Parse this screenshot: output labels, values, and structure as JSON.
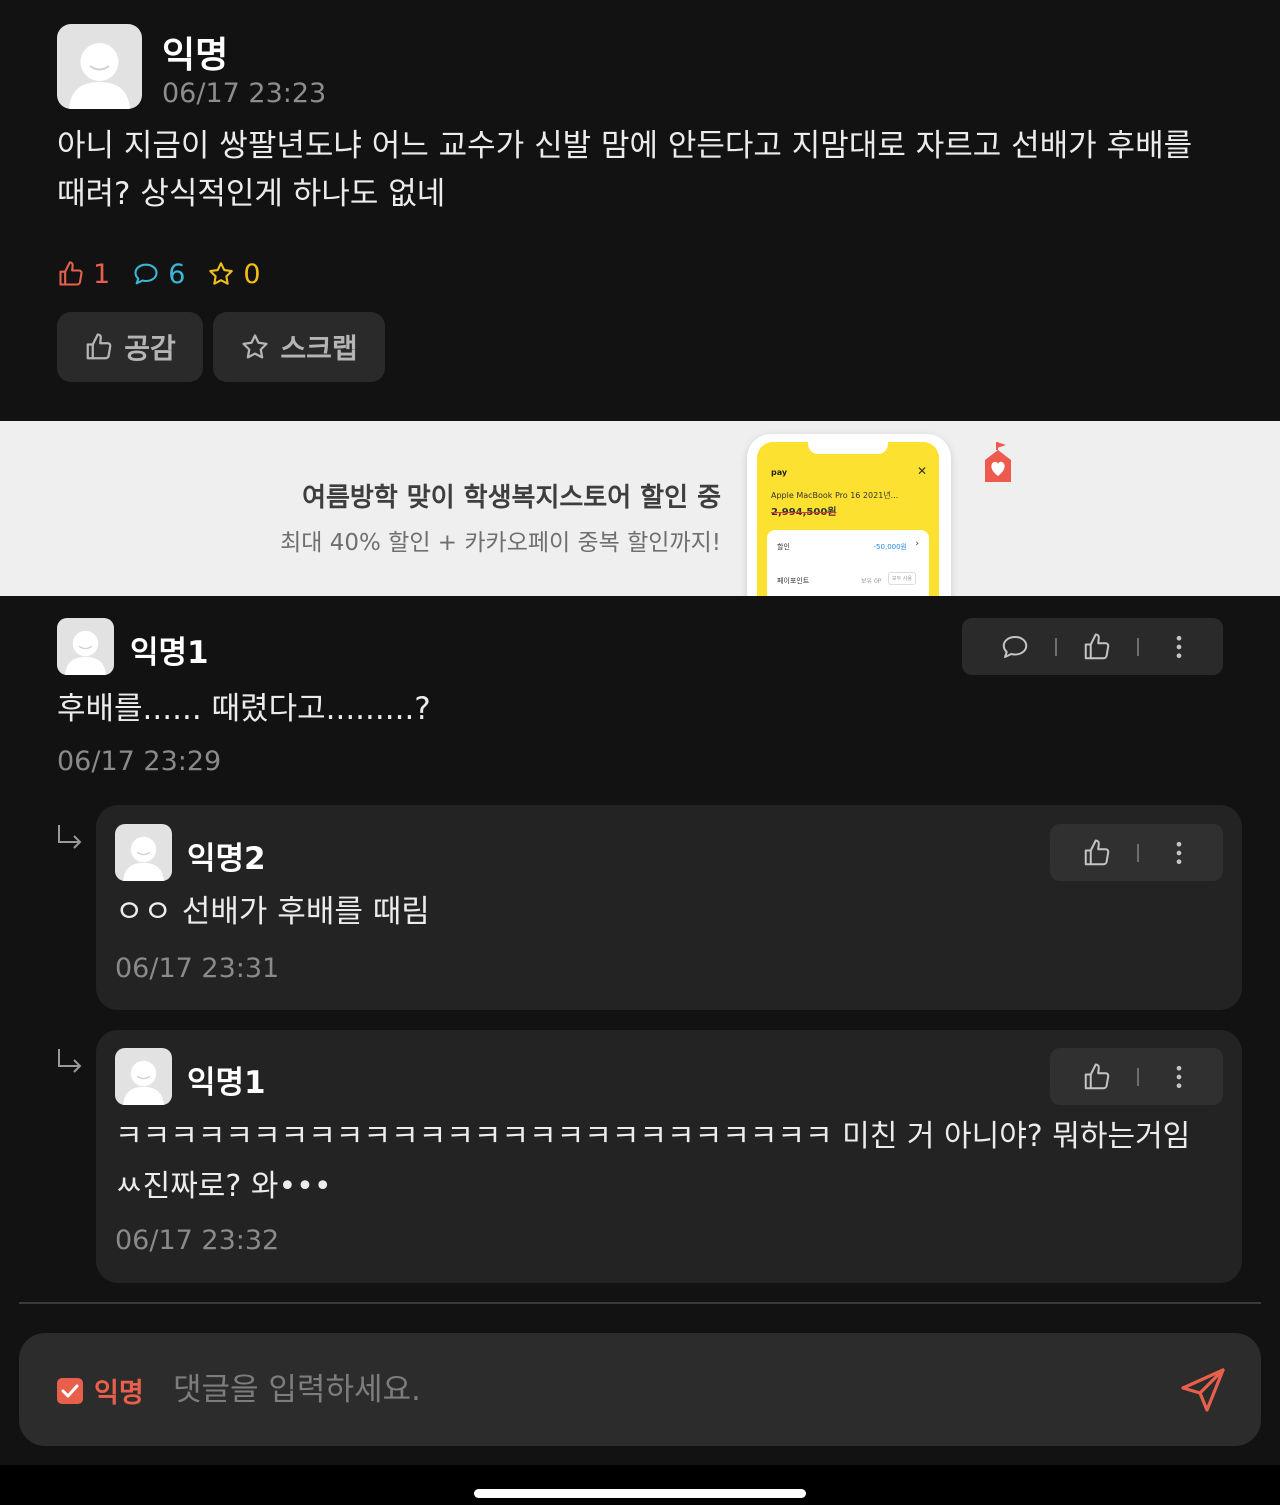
{
  "post": {
    "author": "익명",
    "time": "06/17 23:23",
    "body": "아니 지금이 쌍팔년도냐 어느 교수가 신발 맘에 안든다고 지맘대로 자르고 선배가 후배를 때려? 상식적인게 하나도 없네",
    "likes": "1",
    "comments": "6",
    "scraps": "0",
    "like_button": "공감",
    "scrap_button": "스크랩"
  },
  "ad": {
    "title": "여름방학 맞이 학생복지스토어 할인 중",
    "subtitle": "최대 40% 할인 + 카카오페이 중복 할인까지!",
    "phone": {
      "pay_label": "pay",
      "product": "Apple MacBook Pro 16 2021년...",
      "price": "2,994,500원",
      "discount_label": "할인",
      "discount_value": "-50,000원",
      "point_label": "페이포인트",
      "point_note": "보유 0P",
      "point_button": "모두 사용"
    }
  },
  "comments": [
    {
      "author": "익명1",
      "text": "후배를...... 때렸다고.........?",
      "time": "06/17 23:29"
    }
  ],
  "replies": [
    {
      "author": "익명2",
      "text": "ㅇㅇ 선배가 후배를 때림",
      "time": "06/17 23:31"
    },
    {
      "author": "익명1",
      "text": "ㅋㅋㅋㅋㅋㅋㅋㅋㅋㅋㅋㅋㅋㅋㅋㅋㅋㅋㅋㅋㅋㅋㅋㅋㅋㅋ 미친 거 아니야? 뭐하는거임 ㅆ진짜로? 와•••",
      "time": "06/17 23:32"
    }
  ],
  "input": {
    "anon_label": "익명",
    "anon_checked": true,
    "placeholder": "댓글을 입력하세요."
  },
  "colors": {
    "like": "#e8604c",
    "comment": "#3ab5d6",
    "scrap": "#f0be1b",
    "accent": "#e8604c"
  }
}
